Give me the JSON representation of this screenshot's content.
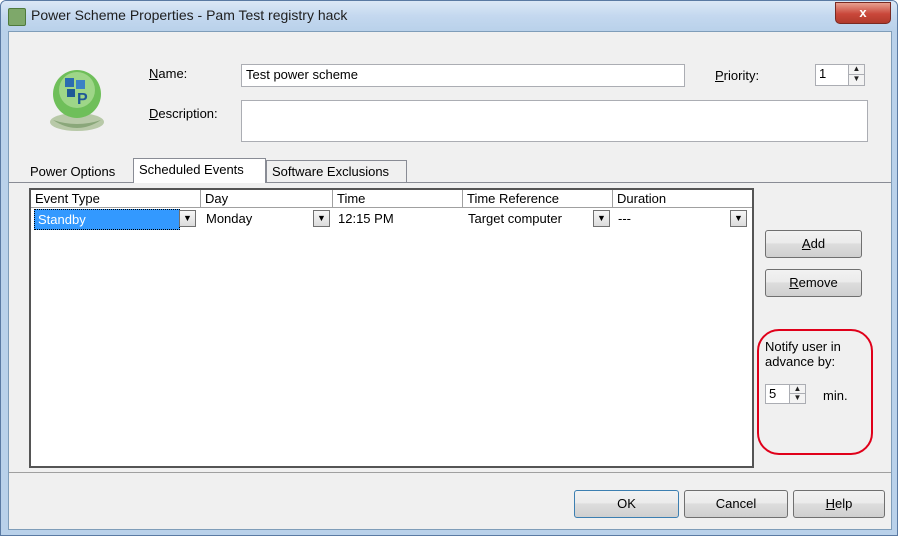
{
  "window": {
    "title": "Power Scheme Properties - Pam Test registry hack",
    "close_label": "x"
  },
  "header": {
    "name_label_prefix": "",
    "name_label_u": "N",
    "name_label_rest": "ame:",
    "name_value": "Test power scheme",
    "description_label_u": "D",
    "description_label_rest": "escription:",
    "description_value": "",
    "priority_label_u": "P",
    "priority_label_rest": "riority:",
    "priority_value": "1"
  },
  "tabs": [
    {
      "label": "Power Options"
    },
    {
      "label": "Scheduled Events"
    },
    {
      "label": "Software Exclusions"
    }
  ],
  "table": {
    "columns": [
      "Event Type",
      "Day",
      "Time",
      "Time Reference",
      "Duration"
    ],
    "rows": [
      {
        "event_type": "Standby",
        "day": "Monday",
        "time": "12:15 PM",
        "time_reference": "Target computer",
        "duration": "---"
      }
    ]
  },
  "side": {
    "add_label_u": "A",
    "add_label_rest": "dd",
    "remove_label_u": "R",
    "remove_label_rest": "emove",
    "notify_line1": "Notify user in",
    "notify_line2": "advance by:",
    "notify_value": "5",
    "notify_unit": "min."
  },
  "footer": {
    "ok_label": "OK",
    "cancel_label": "Cancel",
    "help_label_u": "H",
    "help_label_rest": "elp"
  },
  "colors": {
    "selection": "#3399ff",
    "highlight_circle": "#e0001a",
    "close_button": "#c9473a"
  }
}
